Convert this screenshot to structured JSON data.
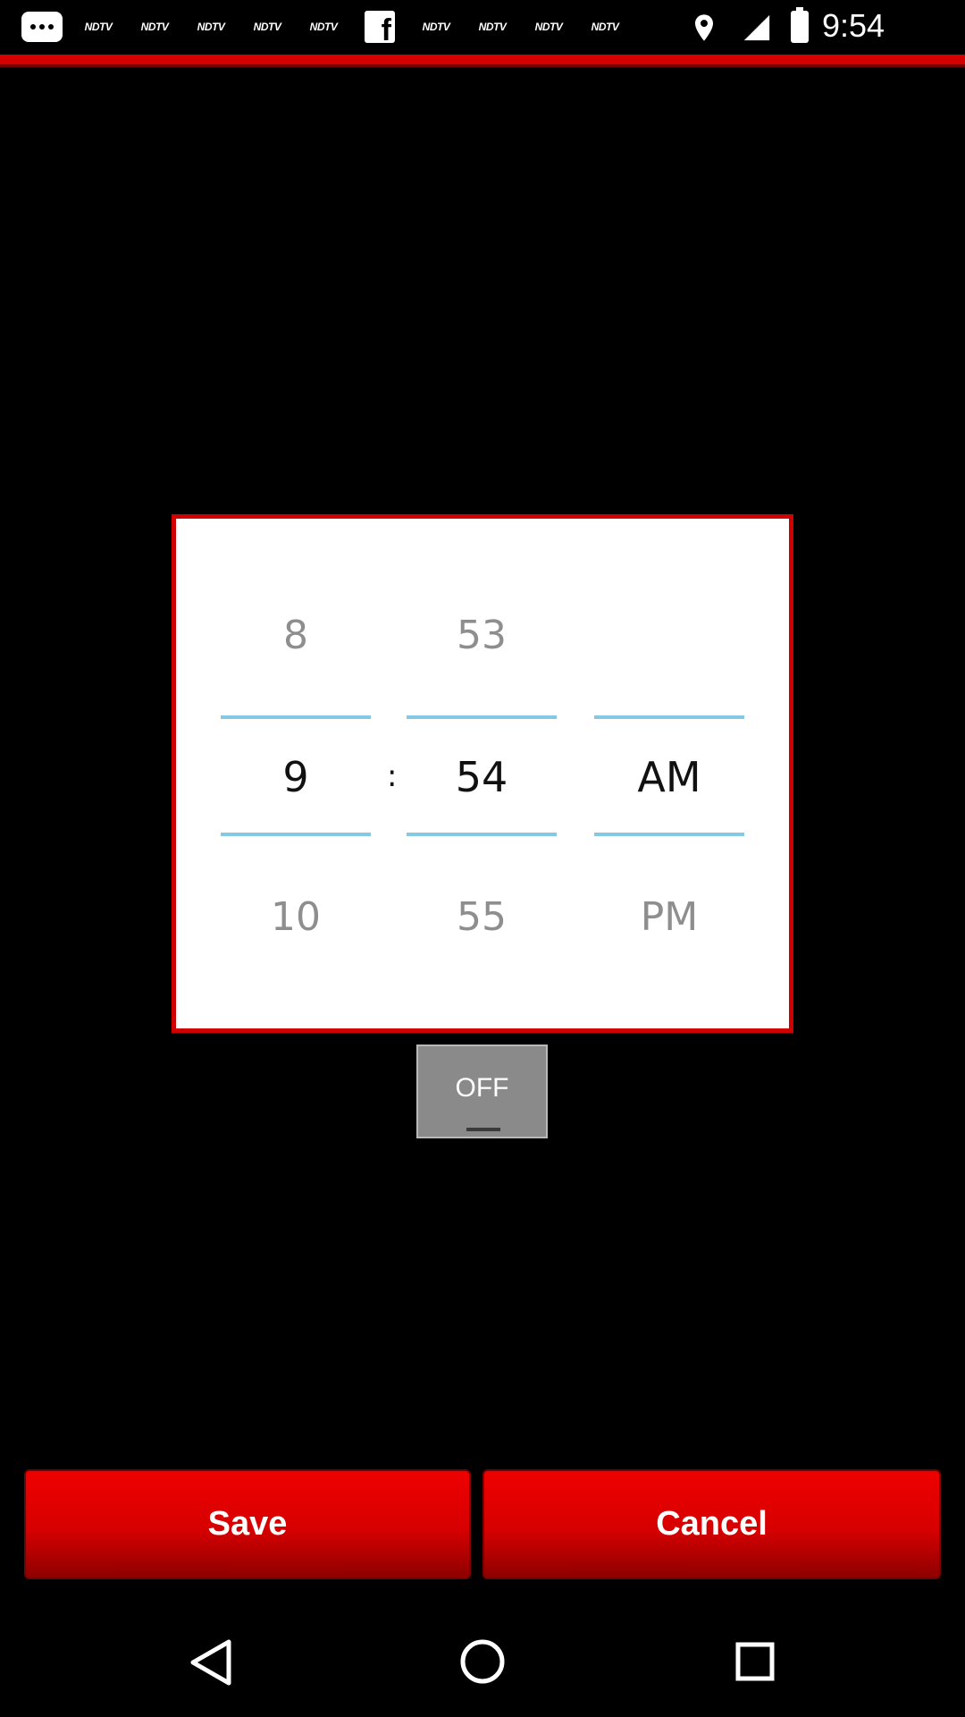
{
  "status_bar": {
    "time": "9:54",
    "notifications": [
      "NDTV",
      "NDTV",
      "NDTV",
      "NDTV",
      "NDTV",
      "facebook",
      "NDTV",
      "NDTV",
      "NDTV",
      "NDTV"
    ],
    "notif_label": "NDTV",
    "fb_glyph": "f",
    "icons": [
      "message-icon",
      "location-icon",
      "signal-icon",
      "battery-icon"
    ]
  },
  "picker": {
    "hour": {
      "prev": "8",
      "current": "9",
      "next": "10"
    },
    "separator": ":",
    "minute": {
      "prev": "53",
      "current": "54",
      "next": "55"
    },
    "ampm": {
      "prev": "",
      "current": "AM",
      "next": "PM"
    }
  },
  "toggle": {
    "label": "OFF"
  },
  "buttons": {
    "save": "Save",
    "cancel": "Cancel"
  },
  "nav": [
    "back-icon",
    "home-icon",
    "recents-icon"
  ],
  "colors": {
    "accent_red": "#d10000",
    "divider_blue": "#84c8e3",
    "toggle_gray": "#8a8a8a"
  }
}
